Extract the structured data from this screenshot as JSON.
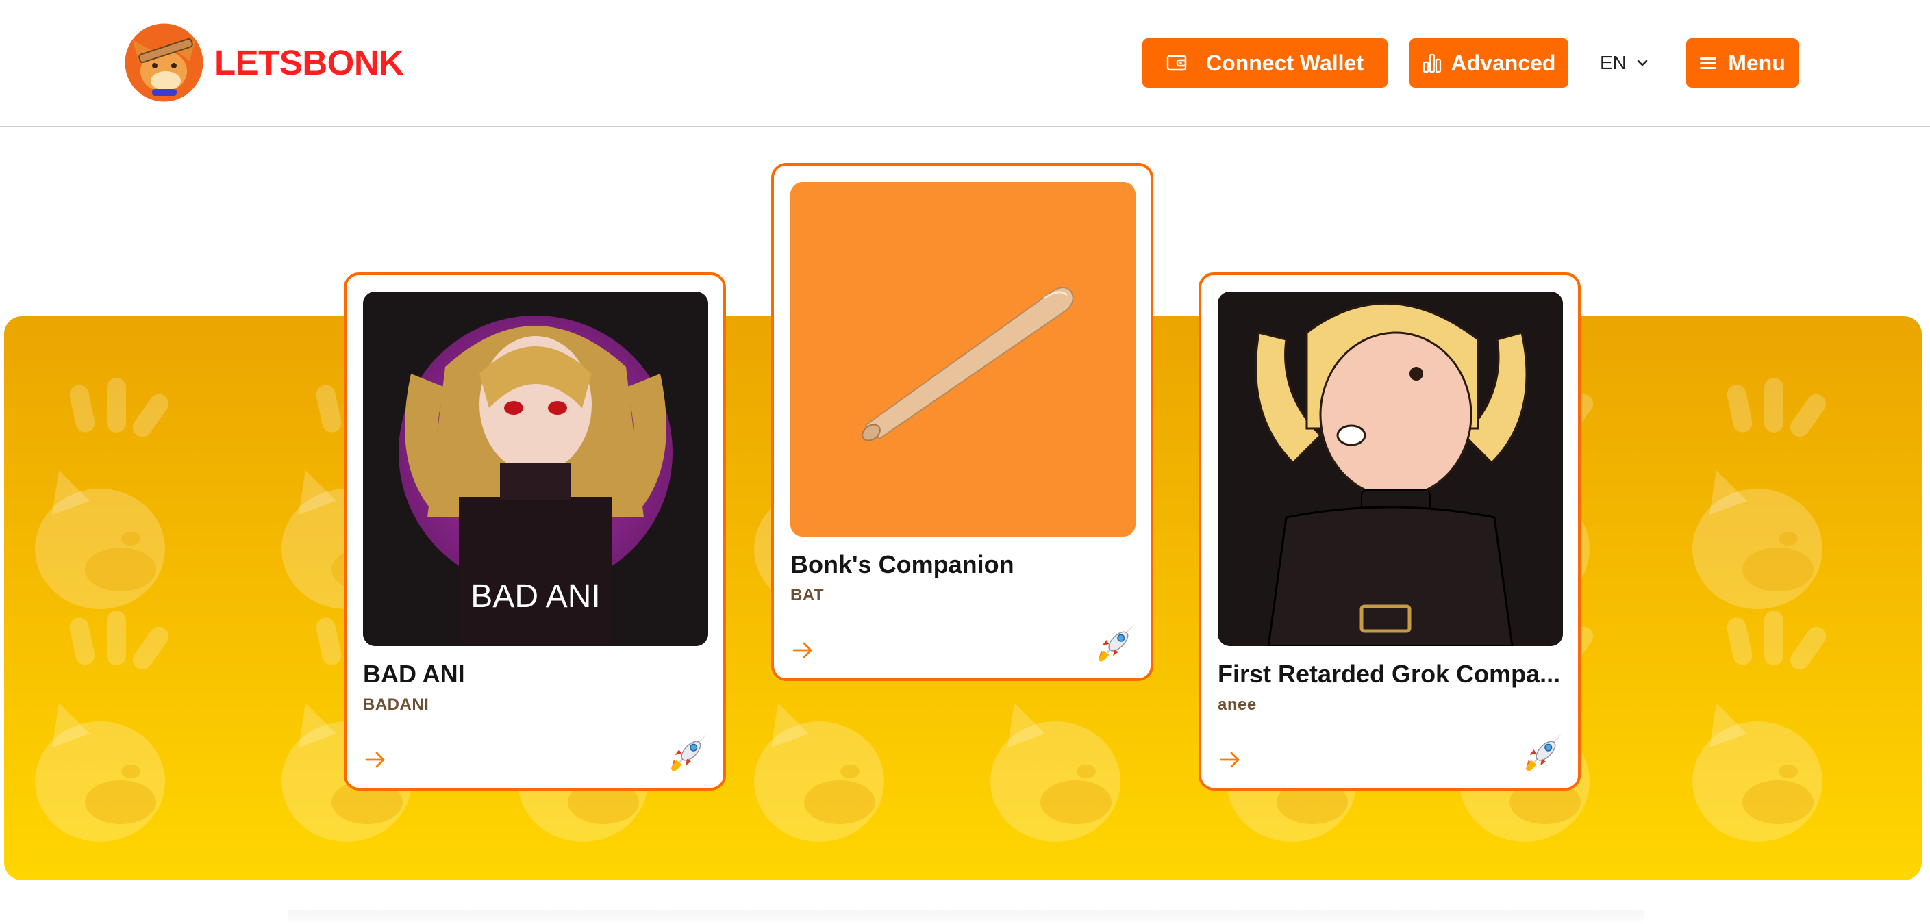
{
  "brand": {
    "name": "LETSBONK",
    "logo_icon": "fox-dog-mascot-icon",
    "color": "#ff1f1f"
  },
  "nav": {
    "connect_wallet": "Connect Wallet",
    "advanced": "Advanced",
    "language": "EN",
    "menu": "Menu",
    "accent": "#ff6a00"
  },
  "banner": {
    "gradient_top": "#eba500",
    "gradient_bottom": "#ffd600",
    "pattern_icon": "bonk-dog-head-icon"
  },
  "cards": [
    {
      "title": "BAD ANI",
      "ticker": "BADANI",
      "image_caption": "BAD ANI",
      "image_icon": "anime-girl-portrait-icon",
      "action_icon": "arrow-right-icon",
      "badge_icon": "rocket-icon"
    },
    {
      "title": "Bonk's Companion",
      "ticker": "BAT",
      "image_icon": "baseball-bat-icon",
      "action_icon": "arrow-right-icon",
      "badge_icon": "rocket-icon"
    },
    {
      "title": "First Retarded Grok Compa...",
      "ticker": "anee",
      "image_icon": "cartoon-blonde-girl-icon",
      "action_icon": "arrow-right-icon",
      "badge_icon": "rocket-icon"
    }
  ]
}
